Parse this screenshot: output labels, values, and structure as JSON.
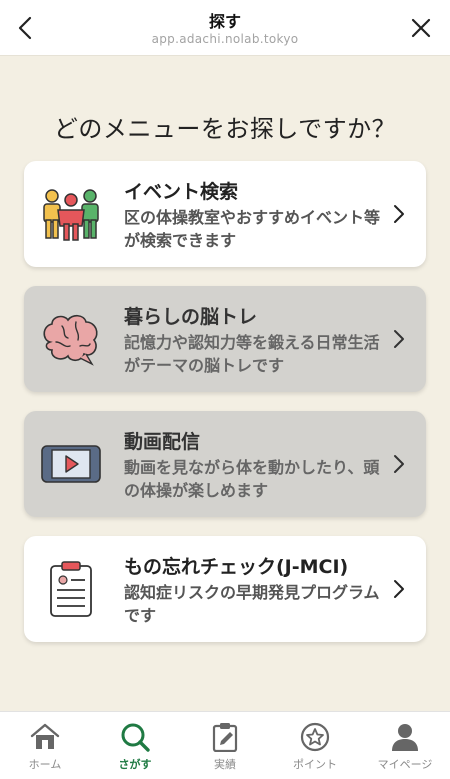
{
  "header": {
    "title": "探す",
    "url": "app.adachi.nolab.tokyo",
    "back_icon": "chevron-left-icon",
    "close_icon": "close-icon"
  },
  "main": {
    "title": "どのメニューをお探しですか？",
    "cards": [
      {
        "title": "イベント検索",
        "desc": "区の体操教室やおすすめイベント等が検索できます",
        "icon": "people-icon",
        "state": "active"
      },
      {
        "title": "暮らしの脳トレ",
        "desc": "記憶力や認知力等を鍛える日常生活がテーマの脳トレです",
        "icon": "brain-icon",
        "state": "disabled"
      },
      {
        "title": "動画配信",
        "desc": "動画を見ながら体を動かしたり、頭の体操が楽しめます",
        "icon": "video-player-icon",
        "state": "disabled"
      },
      {
        "title": "もの忘れチェック(J-MCI)",
        "desc": "認知症リスクの早期発見プログラムです",
        "icon": "clipboard-icon",
        "state": "active"
      }
    ]
  },
  "nav": {
    "items": [
      {
        "label": "ホーム",
        "icon": "home-icon"
      },
      {
        "label": "さがす",
        "icon": "search-icon",
        "active": true
      },
      {
        "label": "実績",
        "icon": "clipboard-pen-icon"
      },
      {
        "label": "ポイント",
        "icon": "star-coin-icon"
      },
      {
        "label": "マイページ",
        "icon": "user-icon"
      }
    ]
  },
  "colors": {
    "background": "#f3efe3",
    "accent_green": "#1f7a43",
    "disabled_card": "#d3d2ce"
  }
}
